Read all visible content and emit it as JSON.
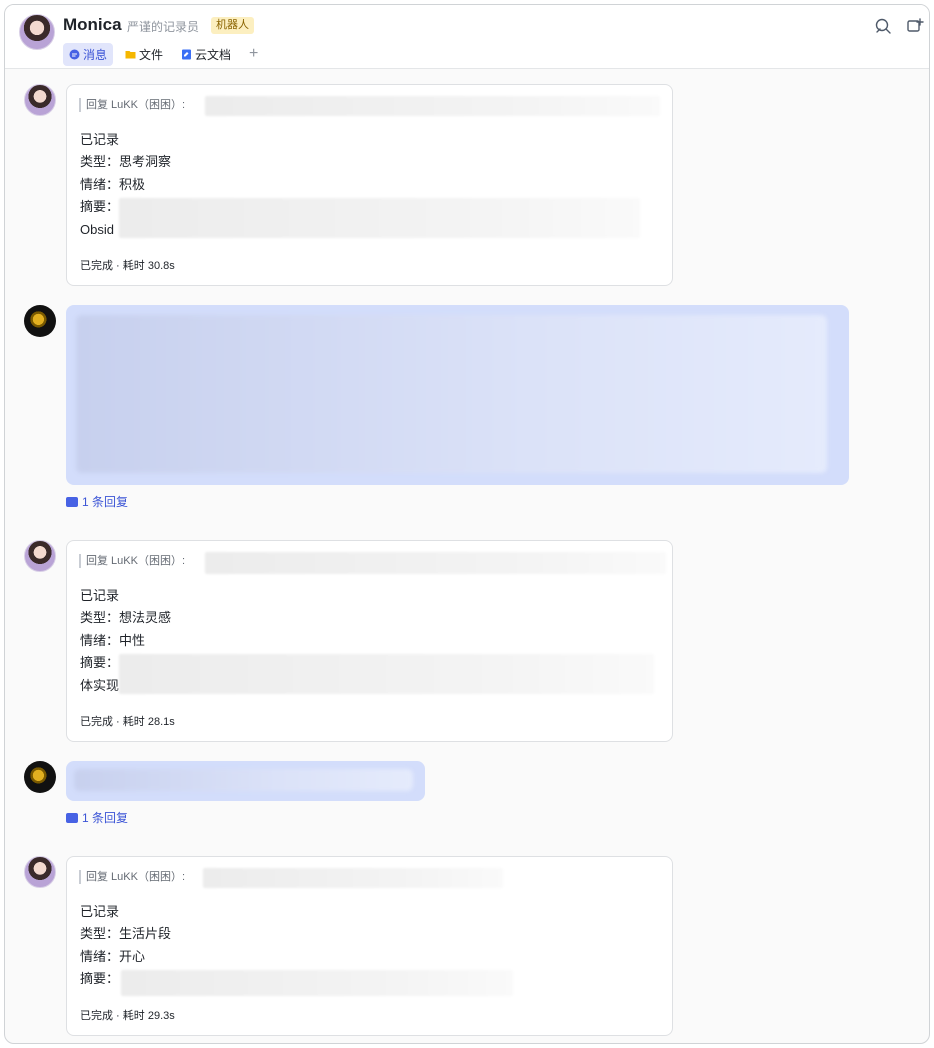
{
  "header": {
    "name": "Monica",
    "description": "严谨的记录员",
    "badge": "机器人",
    "tabs": [
      {
        "label": "消息",
        "icon": "chat-icon",
        "active": true
      },
      {
        "label": "文件",
        "icon": "folder-icon",
        "active": false
      },
      {
        "label": "云文档",
        "icon": "doc-icon",
        "active": false
      }
    ],
    "add_tab": "+",
    "icons": [
      "search-icon",
      "add-chat-icon"
    ]
  },
  "messages": [
    {
      "reply_to": "回复 LuKK（困困）:",
      "lines": [
        "已记录",
        "类型：思考洞察",
        "情绪：积极",
        "摘要：",
        "Obsid"
      ],
      "footer": "已完成 · 耗时 30.8s"
    },
    {
      "reply_count": "1 条回复"
    },
    {
      "reply_to": "回复 LuKK（困困）:",
      "lines": [
        "已记录",
        "类型：想法灵感",
        "情绪：中性",
        "摘要：",
        "体实现"
      ],
      "footer": "已完成 · 耗时 28.1s"
    },
    {
      "reply_count": "1 条回复"
    },
    {
      "reply_to": "回复 LuKK（困困）:",
      "lines": [
        "已记录",
        "类型：生活片段",
        "情绪：开心",
        "摘要："
      ],
      "footer": "已完成 · 耗时 29.3s"
    }
  ],
  "colors": {
    "accent": "#3b54d6",
    "bubble": "#d3ddfb",
    "badge_bg": "#fcefc0"
  }
}
